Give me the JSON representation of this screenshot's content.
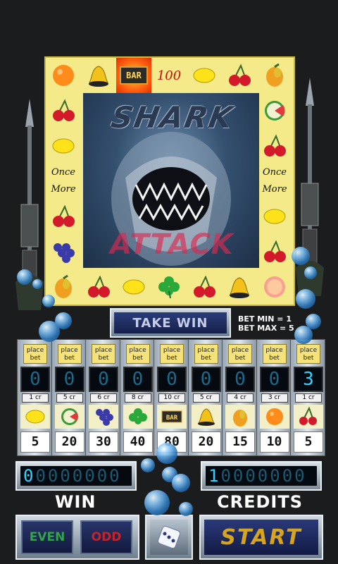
{
  "board": {
    "top_row": [
      "orange",
      "bell",
      "BAR",
      "100",
      "lemon",
      "cherries",
      "mango"
    ],
    "left_col": [
      "cherries",
      "lemon",
      "Once More",
      "cherries",
      "grapes"
    ],
    "right_col": [
      "watermelon",
      "cherries",
      "Once More",
      "lemon",
      "cherries"
    ],
    "bottom_row": [
      "mango",
      "cherries",
      "lemon",
      "clover",
      "cherries",
      "bell",
      "grapefruit"
    ],
    "once_more_label": "Once More",
    "bar_label": "BAR",
    "hundred_label": "100"
  },
  "artwork": {
    "title_top": "SHARK",
    "title_bottom": "ATTACK"
  },
  "take_win": {
    "label": "TAKE WIN"
  },
  "bet_info": {
    "min": "BET MIN = 1",
    "max": "BET MAX = 5"
  },
  "columns": [
    {
      "place": "place\nbet",
      "bet": "0",
      "cr": "1 cr",
      "symbol": "lemon",
      "payout": "5"
    },
    {
      "place": "place\nbet",
      "bet": "0",
      "cr": "5 cr",
      "symbol": "watermelon",
      "payout": "20"
    },
    {
      "place": "place\nbet",
      "bet": "0",
      "cr": "6 cr",
      "symbol": "grapes",
      "payout": "30"
    },
    {
      "place": "place\nbet",
      "bet": "0",
      "cr": "8 cr",
      "symbol": "clover",
      "payout": "40"
    },
    {
      "place": "place\nbet",
      "bet": "0",
      "cr": "10 cr",
      "symbol": "BAR",
      "payout": "80"
    },
    {
      "place": "place\nbet",
      "bet": "0",
      "cr": "5 cr",
      "symbol": "bell",
      "payout": "20"
    },
    {
      "place": "place\nbet",
      "bet": "0",
      "cr": "4 cr",
      "symbol": "mango",
      "payout": "15"
    },
    {
      "place": "place\nbet",
      "bet": "0",
      "cr": "3 cr",
      "symbol": "orange",
      "payout": "10"
    },
    {
      "place": "place\nbet",
      "bet": "3",
      "cr": "1 cr",
      "symbol": "cherries",
      "payout": "5"
    }
  ],
  "win": {
    "label": "WIN",
    "value": "0"
  },
  "credits": {
    "label": "CREDITS",
    "value": "1"
  },
  "buttons": {
    "even": "EVEN",
    "odd": "ODD",
    "start": "START",
    "dice": "dice-icon"
  },
  "colors": {
    "accent_blue": "#2fd1ff",
    "start_gold": "#d6a41e",
    "even_green": "#33a34a",
    "odd_red": "#c2242a"
  }
}
